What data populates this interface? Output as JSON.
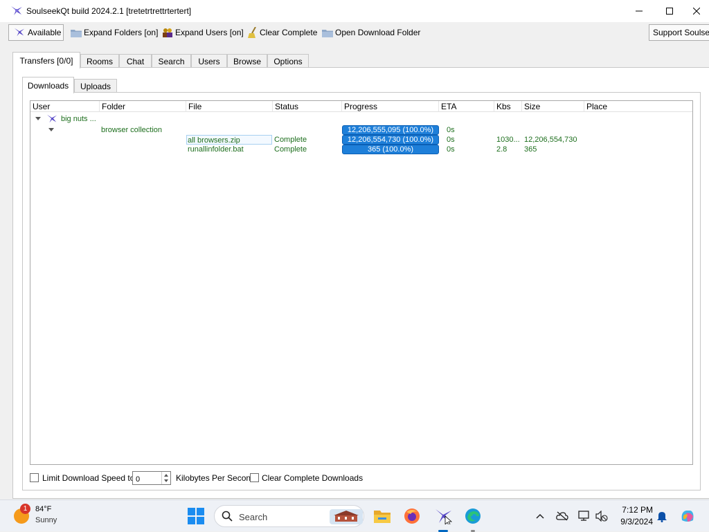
{
  "window": {
    "title": "SoulseekQt build 2024.2.1 [tretetrtrettrtertert]"
  },
  "toolbar": {
    "available": "Available",
    "expand_folders": "Expand Folders [on]",
    "expand_users": "Expand Users [on]",
    "clear_complete": "Clear Complete",
    "open_download_folder": "Open Download Folder",
    "support": "Support Soulseek"
  },
  "main_tabs": [
    "Transfers [0/0]",
    "Rooms",
    "Chat",
    "Search",
    "Users",
    "Browse",
    "Options"
  ],
  "sub_tabs": [
    "Downloads",
    "Uploads"
  ],
  "columns": [
    "User",
    "Folder",
    "File",
    "Status",
    "Progress",
    "ETA",
    "Kbs",
    "Size",
    "Place"
  ],
  "transfers": {
    "user": "big nuts ...",
    "folder": {
      "name": "browser collection",
      "progress": "12,206,555,095 (100.0%)",
      "progress_fraction": 1.0,
      "eta": "0s"
    },
    "files": [
      {
        "file": "all browsers.zip",
        "status": "Complete",
        "progress": "12,206,554,730 (100.0%)",
        "progress_fraction": 1.0,
        "eta": "0s",
        "kbs": "1030...",
        "size": "12,206,554,730",
        "place": ""
      },
      {
        "file": "runallinfolder.bat",
        "status": "Complete",
        "progress": "365 (100.0%)",
        "progress_fraction": 1.0,
        "eta": "0s",
        "kbs": "2.8",
        "size": "365",
        "place": ""
      }
    ]
  },
  "footer": {
    "limit_label": "Limit Download Speed to",
    "limit_checked": false,
    "speed_value": "0",
    "units": "Kilobytes Per Second",
    "clear_label": "Clear Complete Downloads",
    "clear_checked": false
  },
  "taskbar": {
    "weather_badge": "1",
    "temperature": "84°F",
    "condition": "Sunny",
    "search_label": "Search",
    "time": "7:12 PM",
    "date": "9/3/2024"
  },
  "colors": {
    "status_text": "#1d6e1d",
    "progress_fill": "#1e7fd9",
    "accent": "#0067c0"
  }
}
